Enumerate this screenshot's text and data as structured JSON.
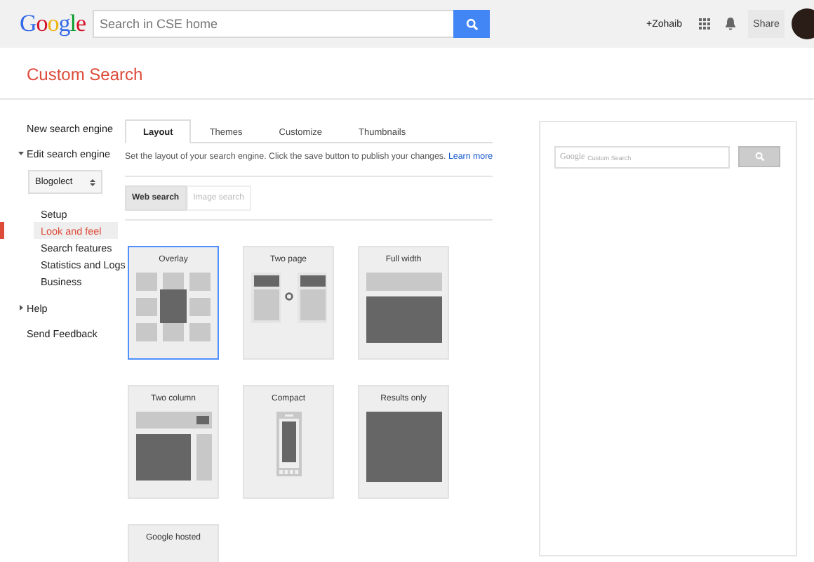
{
  "header": {
    "logo": "Google",
    "search": {
      "placeholder": "Search in CSE home"
    },
    "user": "+Zohaib",
    "share": "Share"
  },
  "page_title": "Custom Search",
  "sidebar": {
    "items": [
      {
        "label": "New search engine",
        "kind": "link"
      },
      {
        "label": "Edit search engine",
        "kind": "expander",
        "expanded": true
      },
      {
        "label": "Blogolect",
        "kind": "select"
      },
      {
        "label": "Setup",
        "kind": "sub",
        "selected": false
      },
      {
        "label": "Look and feel",
        "kind": "sub",
        "selected": true
      },
      {
        "label": "Search features",
        "kind": "sub",
        "selected": false
      },
      {
        "label": "Statistics and Logs",
        "kind": "sub",
        "selected": false
      },
      {
        "label": "Business",
        "kind": "sub",
        "selected": false
      },
      {
        "label": "Help",
        "kind": "expander",
        "expanded": false
      },
      {
        "label": "Send Feedback",
        "kind": "link"
      }
    ]
  },
  "tabs": [
    {
      "label": "Layout",
      "selected": true
    },
    {
      "label": "Themes",
      "selected": false
    },
    {
      "label": "Customize",
      "selected": false
    },
    {
      "label": "Thumbnails",
      "selected": false
    }
  ],
  "description": "Set the layout of your search engine. Click the save button to publish your changes.",
  "learn_more": "Learn more",
  "search_types": [
    {
      "label": "Web search",
      "selected": true
    },
    {
      "label": "Image search",
      "selected": false
    }
  ],
  "layouts": [
    {
      "label": "Overlay",
      "kind": "overlay",
      "selected": true
    },
    {
      "label": "Two page",
      "kind": "two_page",
      "selected": false
    },
    {
      "label": "Full width",
      "kind": "full_width",
      "selected": false
    },
    {
      "label": "Two column",
      "kind": "two_column",
      "selected": false
    },
    {
      "label": "Compact",
      "kind": "compact",
      "selected": false
    },
    {
      "label": "Results only",
      "kind": "results_only",
      "selected": false
    },
    {
      "label": "Google hosted",
      "kind": "google_hosted",
      "selected": false
    }
  ],
  "preview": {
    "brand": "Google",
    "placeholder": "Custom Search"
  }
}
